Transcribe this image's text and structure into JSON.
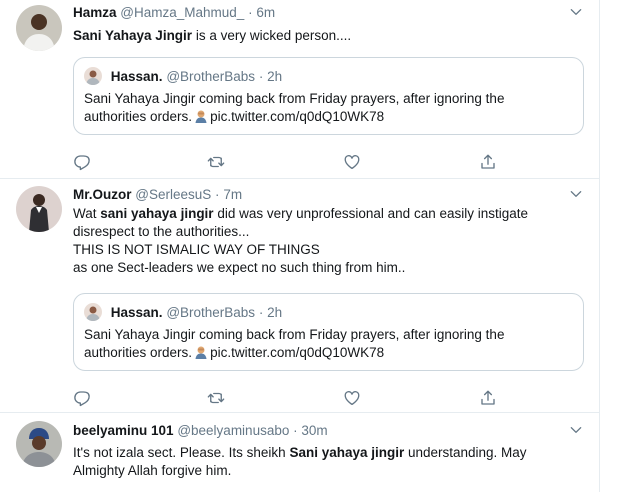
{
  "tweets": [
    {
      "name": "Hamza",
      "handle": "@Hamza_Mahmud_",
      "dot": "·",
      "time": "6m",
      "text_parts": [
        "Sani Yahaya Jingir",
        " is a very wicked person...."
      ],
      "quote": {
        "name": "Hassan.",
        "handle": "@BrotherBabs",
        "dot": "·",
        "time": "2h",
        "line1": "Sani Yahaya Jingir coming back from Friday prayers, after ignoring the",
        "line2a": "authorities orders.",
        "line2b": "pic.twitter.com/q0dQ10WK78"
      }
    },
    {
      "name": "Mr.Ouzor",
      "handle": "@SerleesuS",
      "dot": "·",
      "time": "7m",
      "line1_pre": "Wat ",
      "line1_hl": "sani yahaya jingir",
      "line1_post": " did was very unprofessional and can easily instigate",
      "line2": "disrespect to the authorities...",
      "line3": "THIS IS NOT ISMALIC WAY OF THINGS",
      "line4": "as one Sect-leaders we expect no such thing from him..",
      "quote": {
        "name": "Hassan.",
        "handle": "@BrotherBabs",
        "dot": "·",
        "time": "2h",
        "line1": "Sani Yahaya Jingir coming back from Friday prayers, after ignoring the",
        "line2a": "authorities orders.",
        "line2b": "pic.twitter.com/q0dQ10WK78"
      }
    },
    {
      "name": "beelyaminu 101",
      "handle": "@beelyaminusabo",
      "dot": "·",
      "time": "30m",
      "line1_pre": "It's not izala sect. Please. Its sheikh ",
      "line1_hl": "Sani yahaya jingir",
      "line1_post": " understanding. May",
      "line2": "Almighty Allah forgive him."
    }
  ],
  "icons": [
    "reply-icon",
    "retweet-icon",
    "like-icon",
    "share-icon",
    "chevron-down-icon"
  ],
  "colors": {
    "text": "#14171a",
    "secondary": "#657786",
    "border": "#e6ecf0",
    "quote_border": "#ccd6dd"
  }
}
